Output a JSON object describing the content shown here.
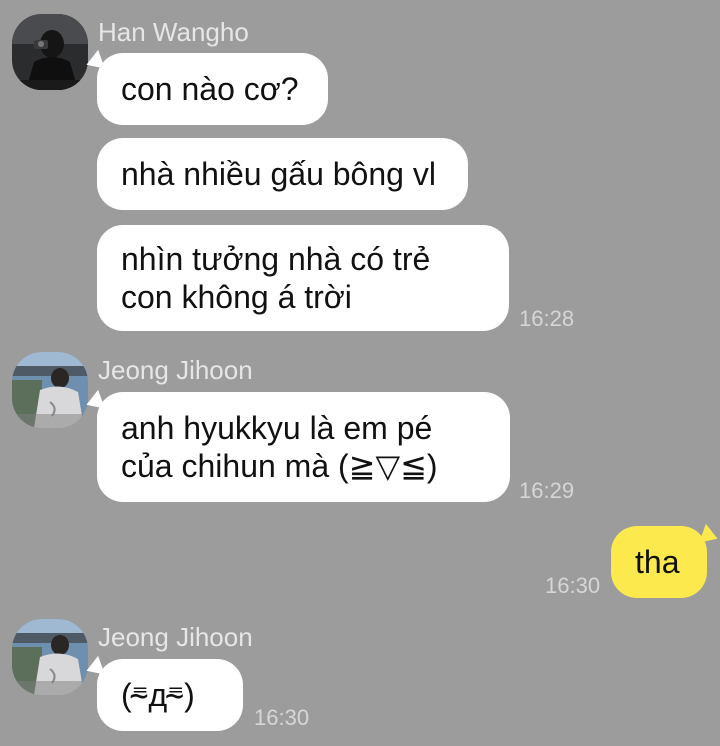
{
  "messages": [
    {
      "sender": "Han Wangho",
      "avatar_icon": "profile-photo-han-wangho",
      "bubbles": [
        {
          "lines": [
            "con nào cơ?"
          ]
        },
        {
          "lines": [
            "nhà nhiều gấu bông vl"
          ]
        },
        {
          "lines": [
            "nhìn tưởng nhà có trẻ",
            "con không á trời"
          ],
          "time": "16:28"
        }
      ]
    },
    {
      "sender": "Jeong Jihoon",
      "avatar_icon": "profile-photo-jeong-jihoon",
      "bubbles": [
        {
          "lines": [
            "anh hyukkyu là em pé",
            "của chihun mà (≧▽≦)"
          ],
          "time": "16:29"
        }
      ]
    },
    {
      "mine": true,
      "bubbles": [
        {
          "lines": [
            "tha"
          ],
          "time": "16:30"
        }
      ]
    },
    {
      "sender": "Jeong Jihoon",
      "avatar_icon": "profile-photo-jeong-jihoon",
      "bubbles": [
        {
          "lines": [
            "(⁼̴д⁼̴)"
          ],
          "time": "16:30"
        }
      ]
    }
  ],
  "colors": {
    "background": "#9c9c9c",
    "incoming_bubble": "#ffffff",
    "outgoing_bubble": "#fce94e",
    "sender_name": "#e6e6e6",
    "timestamp": "#d6d6d6"
  }
}
